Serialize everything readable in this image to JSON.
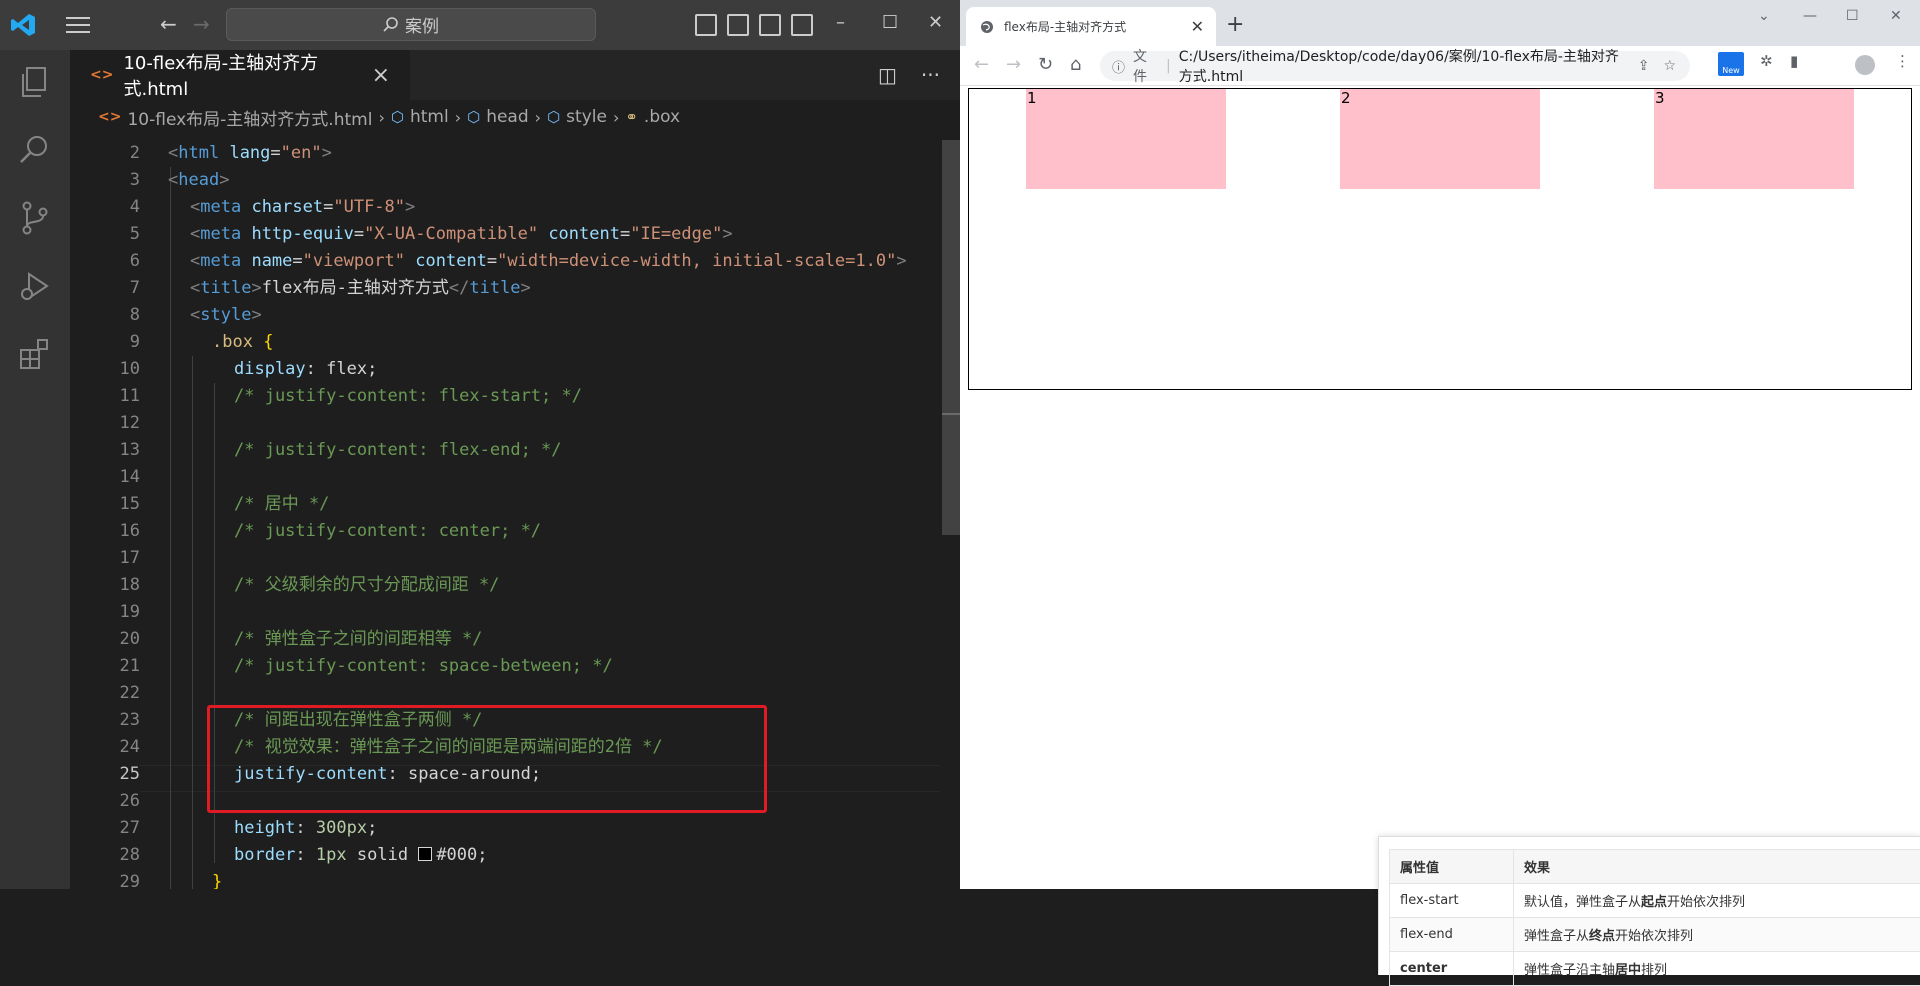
{
  "vscode": {
    "search_text": "案例",
    "tab": {
      "label": "10-flex布局-主轴对齐方式.html"
    },
    "breadcrumb": [
      "10-flex布局-主轴对齐方式.html",
      "html",
      "head",
      "style",
      ".box"
    ],
    "line_numbers": [
      "2",
      "3",
      "4",
      "5",
      "6",
      "7",
      "8",
      "9",
      "10",
      "11",
      "12",
      "13",
      "14",
      "15",
      "16",
      "17",
      "18",
      "19",
      "20",
      "21",
      "22",
      "23",
      "24",
      "25",
      "26",
      "27",
      "28",
      "29"
    ],
    "active_line": "25",
    "code": {
      "l2_tag": "html",
      "l2_attr": "lang",
      "l2_val": "\"en\"",
      "l3_tag": "head",
      "l4_tag": "meta",
      "l4_attr": "charset",
      "l4_val": "\"UTF-8\"",
      "l5_tag": "meta",
      "l5_attr1": "http-equiv",
      "l5_val1": "\"X-UA-Compatible\"",
      "l5_attr2": "content",
      "l5_val2": "\"IE=edge\"",
      "l6_tag": "meta",
      "l6_attr1": "name",
      "l6_val1": "\"viewport\"",
      "l6_attr2": "content",
      "l6_val2": "\"width=device-width, initial-scale=1.0\"",
      "l7_tag": "title",
      "l7_text": "flex布局-主轴对齐方式",
      "l7_close": "title",
      "l8_tag": "style",
      "l9_sel": ".box",
      "l10_prop": "display",
      "l10_val": "flex;",
      "l11": "/* justify-content: flex-start; */",
      "l13": "/* justify-content: flex-end; */",
      "l15": "/* 居中 */",
      "l16": "/* justify-content: center; */",
      "l18": "/* 父级剩余的尺寸分配成间距 */",
      "l20": "/* 弹性盒子之间的间距相等 */",
      "l21": "/* justify-content: space-between; */",
      "l23": "/* 间距出现在弹性盒子两侧 */",
      "l24": "/* 视觉效果：弹性盒子之间的间距是两端间距的2倍 */",
      "l25_prop": "justify-content",
      "l25_val": "space-around;",
      "l27_prop": "height",
      "l27_num": "300px",
      "l27_semi": ";",
      "l28_prop": "border",
      "l28_num": "1px",
      "l28_val": "solid",
      "l28_color": "#000;"
    }
  },
  "browser": {
    "tab_title": "flex布局-主轴对齐方式",
    "address_prefix": "文件",
    "address": "C:/Users/itheima/Desktop/code/day06/案例/10-flex布局-主轴对齐方式.html",
    "extension_badge": "New",
    "flex_items": [
      "1",
      "2",
      "3"
    ],
    "flex_item_color": "#ffc0cb",
    "reference_table": {
      "headers": [
        "属性值",
        "效果"
      ],
      "rows": [
        {
          "value": "flex-start",
          "effect_pre": "默认值，弹性盒子从",
          "effect_bold": "起点",
          "effect_post": "开始依次排列"
        },
        {
          "value": "flex-end",
          "effect_pre": "弹性盒子从",
          "effect_bold": "终点",
          "effect_post": "开始依次排列"
        },
        {
          "value": "center",
          "effect_pre": "弹性盒子沿主轴",
          "effect_bold": "居中",
          "effect_post": "排列"
        }
      ]
    }
  },
  "colors": {
    "highlight_box": "#e01b24",
    "vscode_bg": "#1e1e1e",
    "title_bar": "#3c3c3c"
  }
}
